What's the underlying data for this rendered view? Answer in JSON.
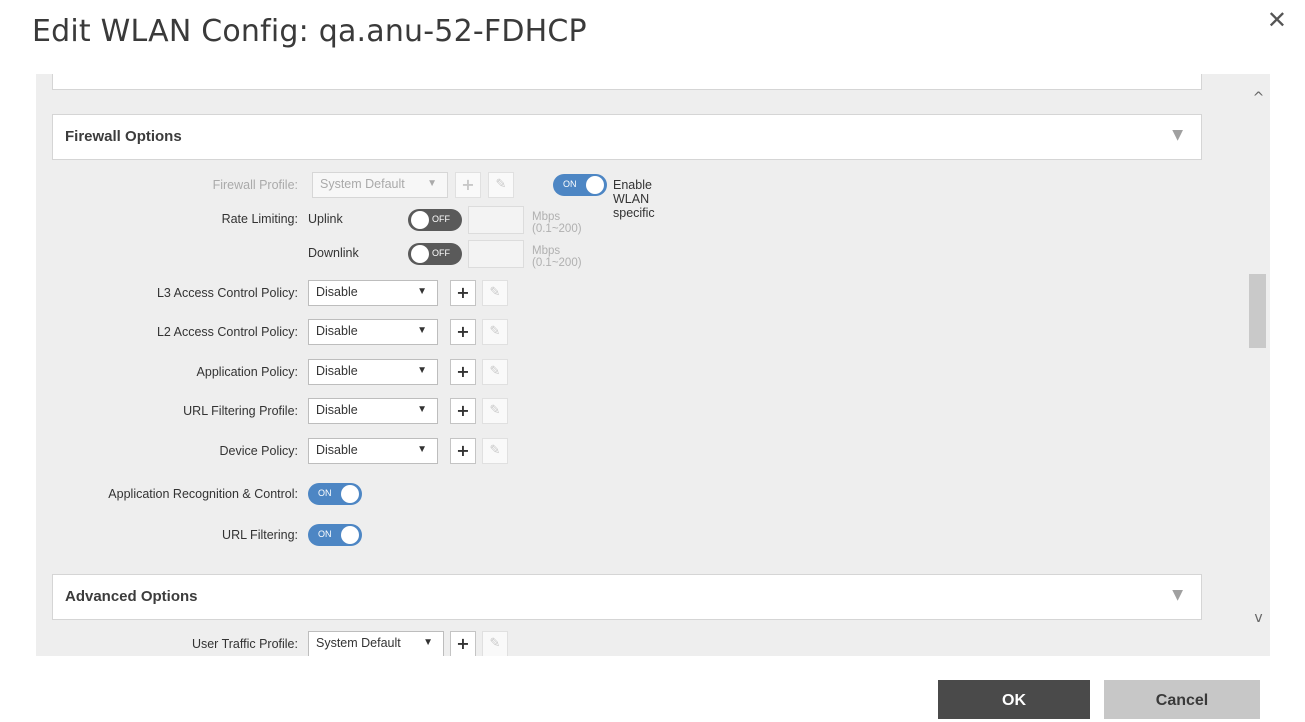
{
  "dialog": {
    "title": "Edit WLAN Config: qa.anu-52-FDHCP",
    "close_glyph": "✕"
  },
  "firewall_section": {
    "title": "Firewall Options",
    "caret": "▼",
    "firewall_profile": {
      "label": "Firewall Profile:",
      "value": "System Default",
      "toggle_label": "ON",
      "toggle_text": "Enable WLAN specific"
    },
    "rate_limiting": {
      "label": "Rate Limiting:",
      "uplink": {
        "label": "Uplink",
        "toggle": "OFF",
        "hint": "Mbps (0.1~200)"
      },
      "downlink": {
        "label": "Downlink",
        "toggle": "OFF",
        "hint": "Mbps (0.1~200)"
      }
    },
    "policies": [
      {
        "label": "L3 Access Control Policy:",
        "value": "Disable"
      },
      {
        "label": "L2 Access Control Policy:",
        "value": "Disable"
      },
      {
        "label": "Application Policy:",
        "value": "Disable"
      },
      {
        "label": "URL Filtering Profile:",
        "value": "Disable"
      },
      {
        "label": "Device Policy:",
        "value": "Disable"
      }
    ],
    "app_recognition": {
      "label": "Application Recognition & Control:",
      "toggle": "ON"
    },
    "url_filtering": {
      "label": "URL Filtering:",
      "toggle": "ON"
    }
  },
  "advanced_section": {
    "title": "Advanced Options",
    "caret": "▼",
    "user_traffic_profile": {
      "label": "User Traffic Profile:",
      "value": "System Default"
    }
  },
  "icons": {
    "plus": "+",
    "pencil": "✎",
    "select_arrow": "▼",
    "scroll_up": "^",
    "scroll_down": "v"
  },
  "buttons": {
    "ok": "OK",
    "cancel": "Cancel"
  },
  "colors": {
    "toggle_on": "#4d86c4",
    "toggle_off": "#5a5a5a",
    "ok_bg": "#4a4a4a",
    "cancel_bg": "#c7c7c7"
  }
}
